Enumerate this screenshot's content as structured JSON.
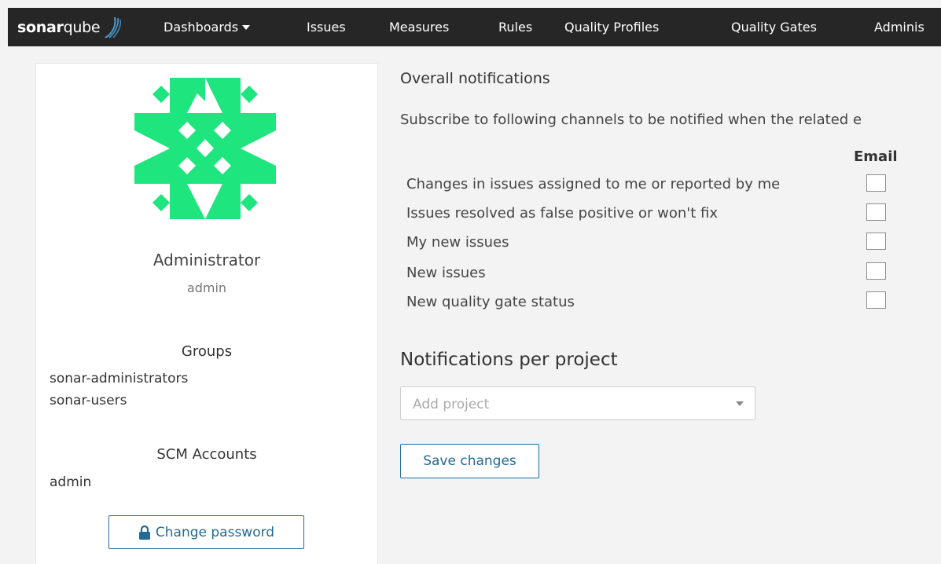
{
  "nav": {
    "brand_bold": "sonar",
    "brand_rest": "qube",
    "items": [
      {
        "label": "Dashboards"
      },
      {
        "label": "Issues"
      },
      {
        "label": "Measures"
      },
      {
        "label": "Rules"
      },
      {
        "label": "Quality Profiles"
      },
      {
        "label": "Quality Gates"
      },
      {
        "label": "Adminis"
      }
    ]
  },
  "profile": {
    "name": "Administrator",
    "login": "admin",
    "avatar_color": "#1ee57e",
    "groups_title": "Groups",
    "groups": [
      "sonar-administrators",
      "sonar-users"
    ],
    "scm_title": "SCM Accounts",
    "scm_accounts": [
      "admin"
    ],
    "change_password_label": "Change password"
  },
  "notifications": {
    "overall_title": "Overall notifications",
    "subscribe_text": "Subscribe to following channels to be notified when the related e",
    "email_column": "Email",
    "items": [
      {
        "label": "Changes in issues assigned to me or reported by me",
        "email": false
      },
      {
        "label": "Issues resolved as false positive or won't fix",
        "email": false
      },
      {
        "label": "My new issues",
        "email": false
      },
      {
        "label": "New issues",
        "email": false
      },
      {
        "label": "New quality gate status",
        "email": false
      }
    ],
    "per_project_title": "Notifications per project",
    "add_project_placeholder": "Add project",
    "save_label": "Save changes"
  },
  "colors": {
    "navbar": "#262626",
    "accent": "#236a97"
  }
}
